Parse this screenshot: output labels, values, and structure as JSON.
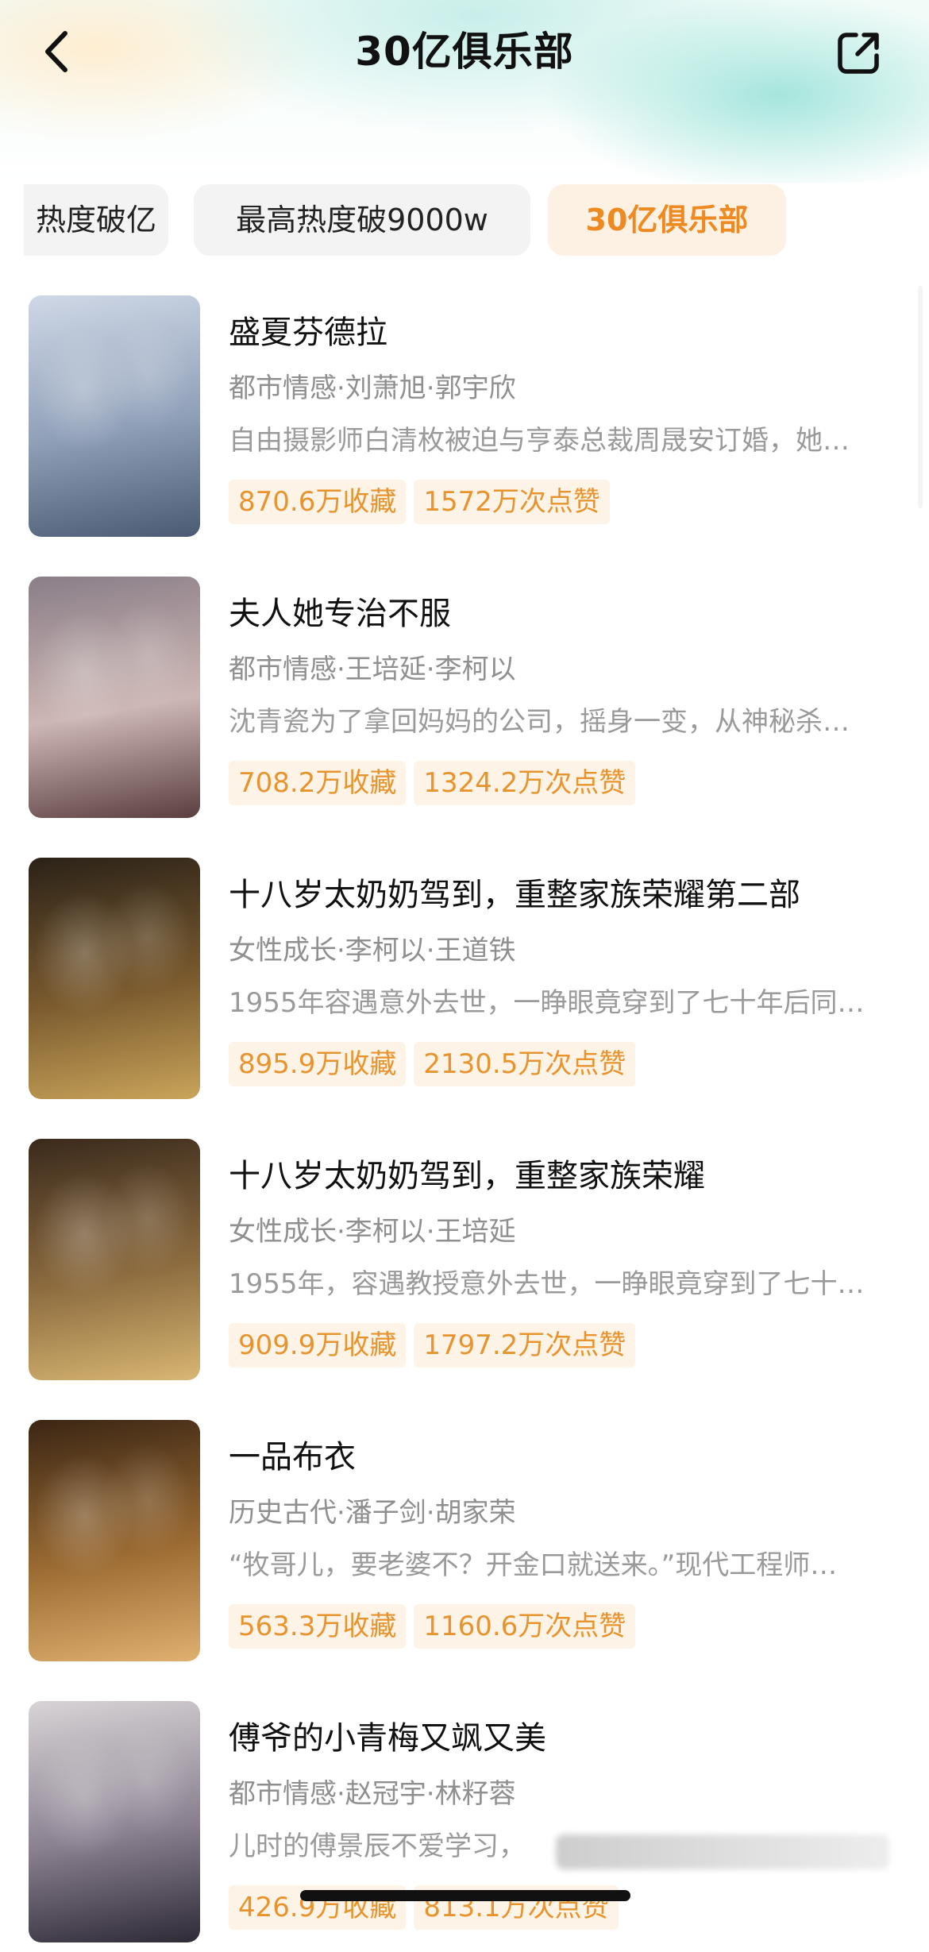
{
  "header": {
    "title": "30亿俱乐部",
    "back_icon": "chevron-left-icon",
    "share_icon": "share-icon"
  },
  "tabs": [
    {
      "label": "热度破亿",
      "active": false
    },
    {
      "label": "最高热度破9000w",
      "active": false
    },
    {
      "label": "30亿俱乐部",
      "active": true
    }
  ],
  "items": [
    {
      "title": "盛夏芬德拉",
      "meta": "都市情感·刘萧旭·郭宇欣",
      "desc": "自由摄影师白清枚被迫与亨泰总裁周晟安订婚，她…",
      "favorites": "870.6万收藏",
      "likes": "1572万次点赞",
      "cover_text": "",
      "cover_colors": [
        "#cfd8e6",
        "#8f9fb8",
        "#4a5a72"
      ]
    },
    {
      "title": "夫人她专治不服",
      "meta": "都市情感·王培延·李柯以",
      "desc": "沈青瓷为了拿回妈妈的公司，摇身一变，从神秘杀…",
      "favorites": "708.2万收藏",
      "likes": "1324.2万次点赞",
      "cover_text": "",
      "cover_colors": [
        "#8a7e88",
        "#cdb7b4",
        "#5a3e40"
      ]
    },
    {
      "title": "十八岁太奶奶驾到，重整家族荣耀第二部",
      "meta": "女性成长·李柯以·王道铁",
      "desc": "1955年容遇意外去世，一睁眼竟穿到了七十年后同…",
      "favorites": "895.9万收藏",
      "likes": "2130.5万次点赞",
      "cover_text": "",
      "cover_colors": [
        "#2b2218",
        "#7a5a2e",
        "#c9a45a"
      ]
    },
    {
      "title": "十八岁太奶奶驾到，重整家族荣耀",
      "meta": "女性成长·李柯以·王培延",
      "desc": "1955年，容遇教授意外去世，一睁眼竟穿到了七十…",
      "favorites": "909.9万收藏",
      "likes": "1797.2万次点赞",
      "cover_text": "",
      "cover_colors": [
        "#3a2a1c",
        "#8b6a3e",
        "#d8b673"
      ]
    },
    {
      "title": "一品布衣",
      "meta": "历史古代·潘子剑·胡家荣",
      "desc": "“牧哥儿，要老婆不？开金口就送来。”现代工程师…",
      "favorites": "563.3万收藏",
      "likes": "1160.6万次点赞",
      "cover_text": "",
      "cover_colors": [
        "#3b2614",
        "#9a6a32",
        "#e0b070"
      ]
    },
    {
      "title": "傅爷的小青梅又飒又美",
      "meta": "都市情感·赵冠宇·林籽蓉",
      "desc": "儿时的傅景辰不爱学习，",
      "favorites": "426.9万收藏",
      "likes": "813.1万次点赞",
      "cover_text": "",
      "cover_colors": [
        "#d8d4d6",
        "#8a8090",
        "#2e2a36"
      ]
    }
  ]
}
